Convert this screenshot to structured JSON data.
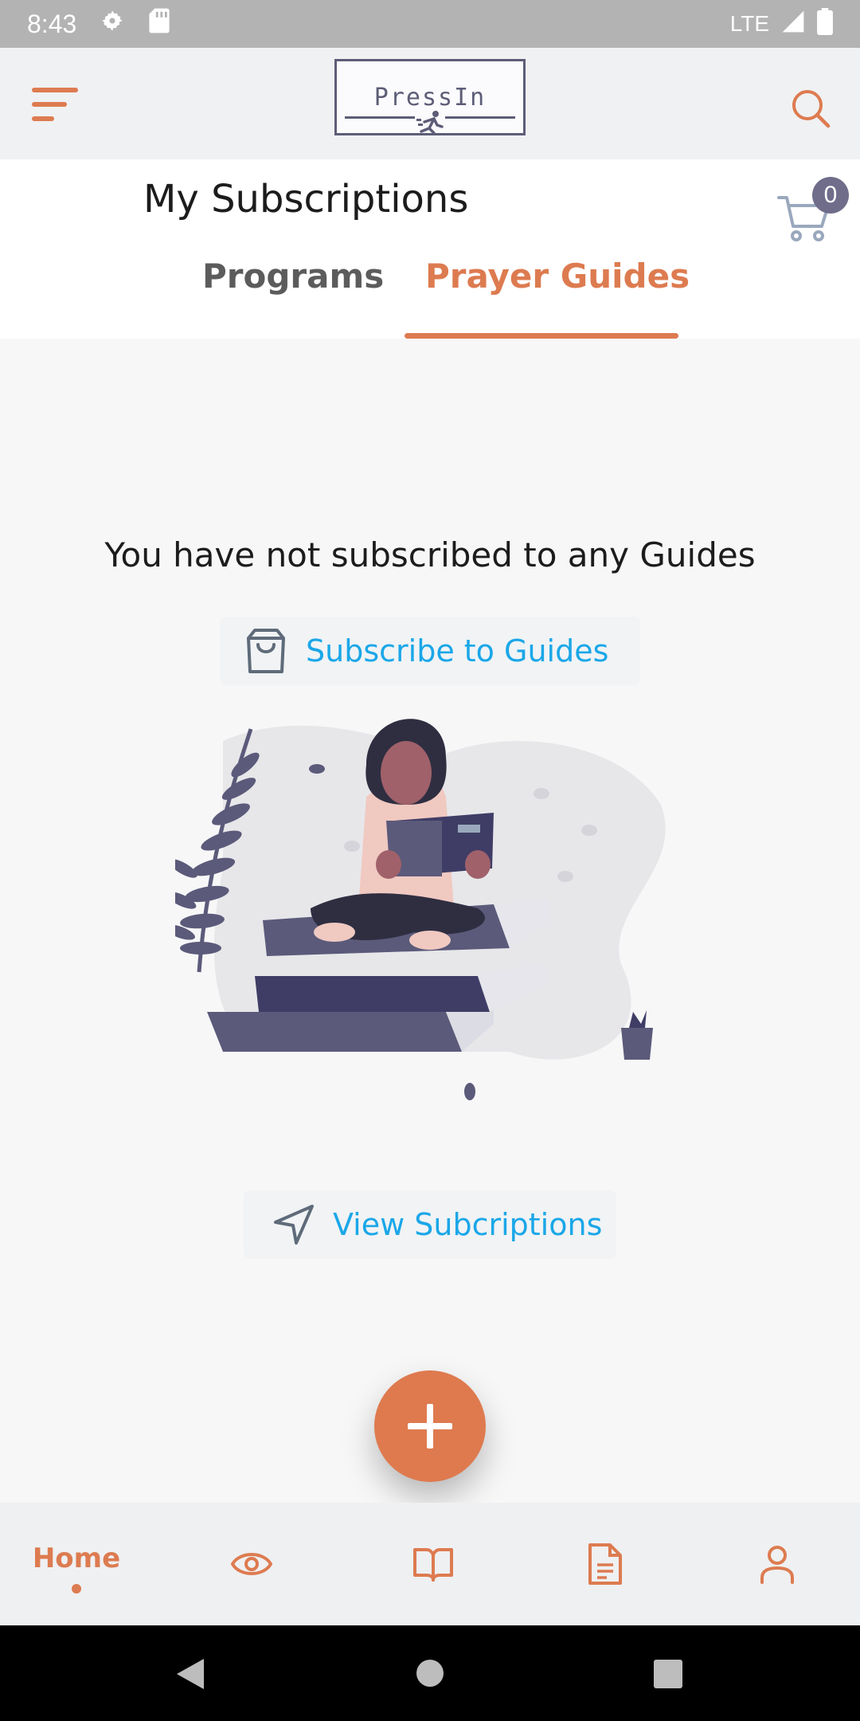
{
  "status_bar": {
    "time": "8:43",
    "network": "LTE"
  },
  "app_bar": {
    "logo_text": "PressIn"
  },
  "header": {
    "title": "My Subscriptions",
    "cart_count": "0"
  },
  "tabs": [
    {
      "label": "Programs",
      "active": false
    },
    {
      "label": "Prayer Guides",
      "active": true
    }
  ],
  "main": {
    "empty_message": "You have not subscribed to any Guides",
    "subscribe_label": "Subscribe to  Guides",
    "view_label": "View Subcriptions"
  },
  "bottom_nav": {
    "home_label": "Home"
  },
  "colors": {
    "accent": "#dd7b50",
    "link": "#1aa7e8",
    "illustration": "#5b5a7a"
  }
}
